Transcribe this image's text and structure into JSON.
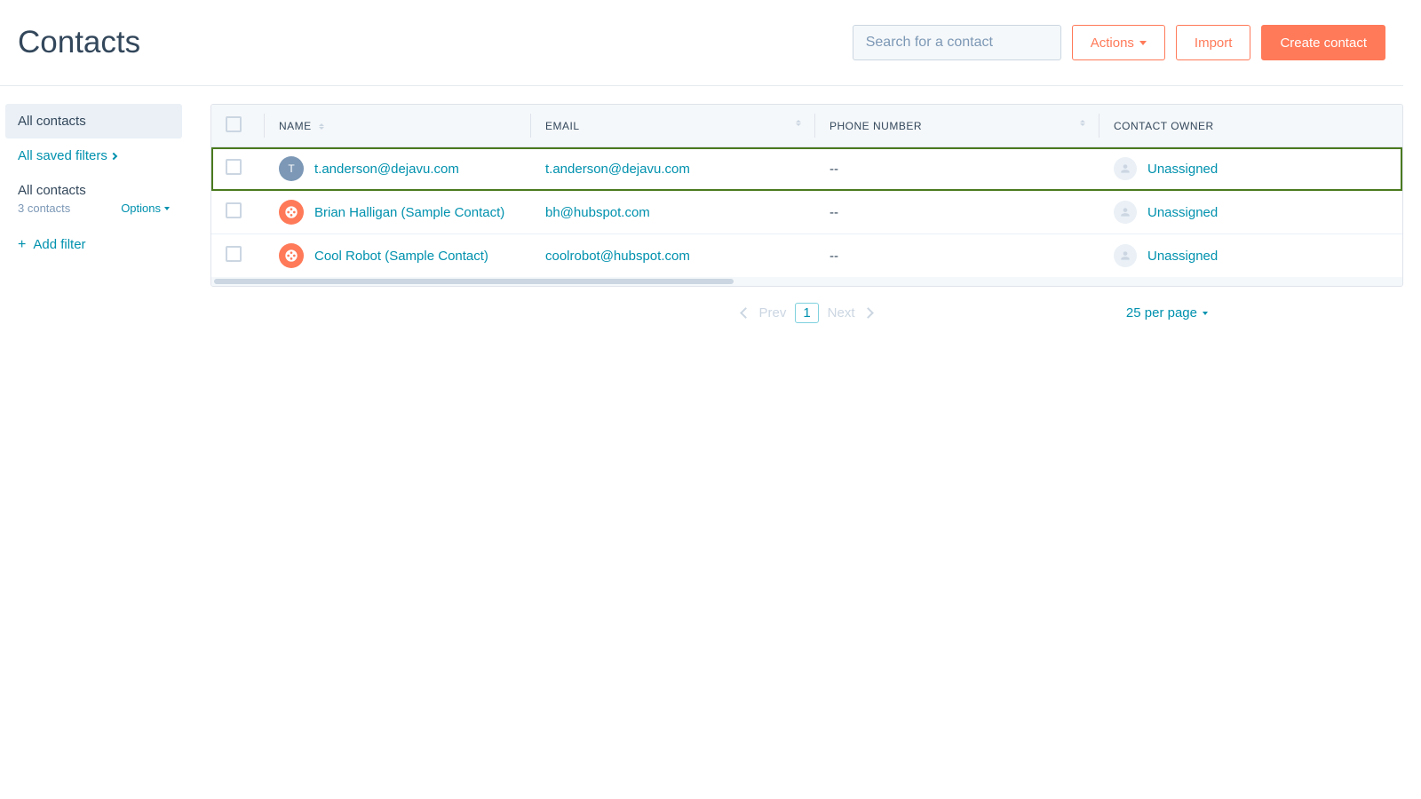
{
  "header": {
    "title": "Contacts",
    "search_placeholder": "Search for a contact",
    "actions_label": "Actions",
    "import_label": "Import",
    "create_label": "Create contact"
  },
  "sidebar": {
    "all_contacts": "All contacts",
    "saved_filters": "All saved filters",
    "section_heading": "All contacts",
    "count_text": "3 contacts",
    "options_label": "Options",
    "add_filter": "Add filter"
  },
  "table": {
    "columns": {
      "name": "NAME",
      "email": "EMAIL",
      "phone": "PHONE NUMBER",
      "owner": "CONTACT OWNER"
    },
    "rows": [
      {
        "avatar_letter": "T",
        "avatar_style": "grey",
        "name": "t.anderson@dejavu.com",
        "email": "t.anderson@dejavu.com",
        "phone": "--",
        "owner": "Unassigned",
        "highlight": true
      },
      {
        "avatar_letter": "",
        "avatar_style": "orange",
        "name": "Brian Halligan (Sample Contact)",
        "email": "bh@hubspot.com",
        "phone": "--",
        "owner": "Unassigned",
        "highlight": false
      },
      {
        "avatar_letter": "",
        "avatar_style": "orange",
        "name": "Cool Robot (Sample Contact)",
        "email": "coolrobot@hubspot.com",
        "phone": "--",
        "owner": "Unassigned",
        "highlight": false
      }
    ]
  },
  "pagination": {
    "prev": "Prev",
    "page": "1",
    "next": "Next",
    "per_page": "25 per page"
  }
}
